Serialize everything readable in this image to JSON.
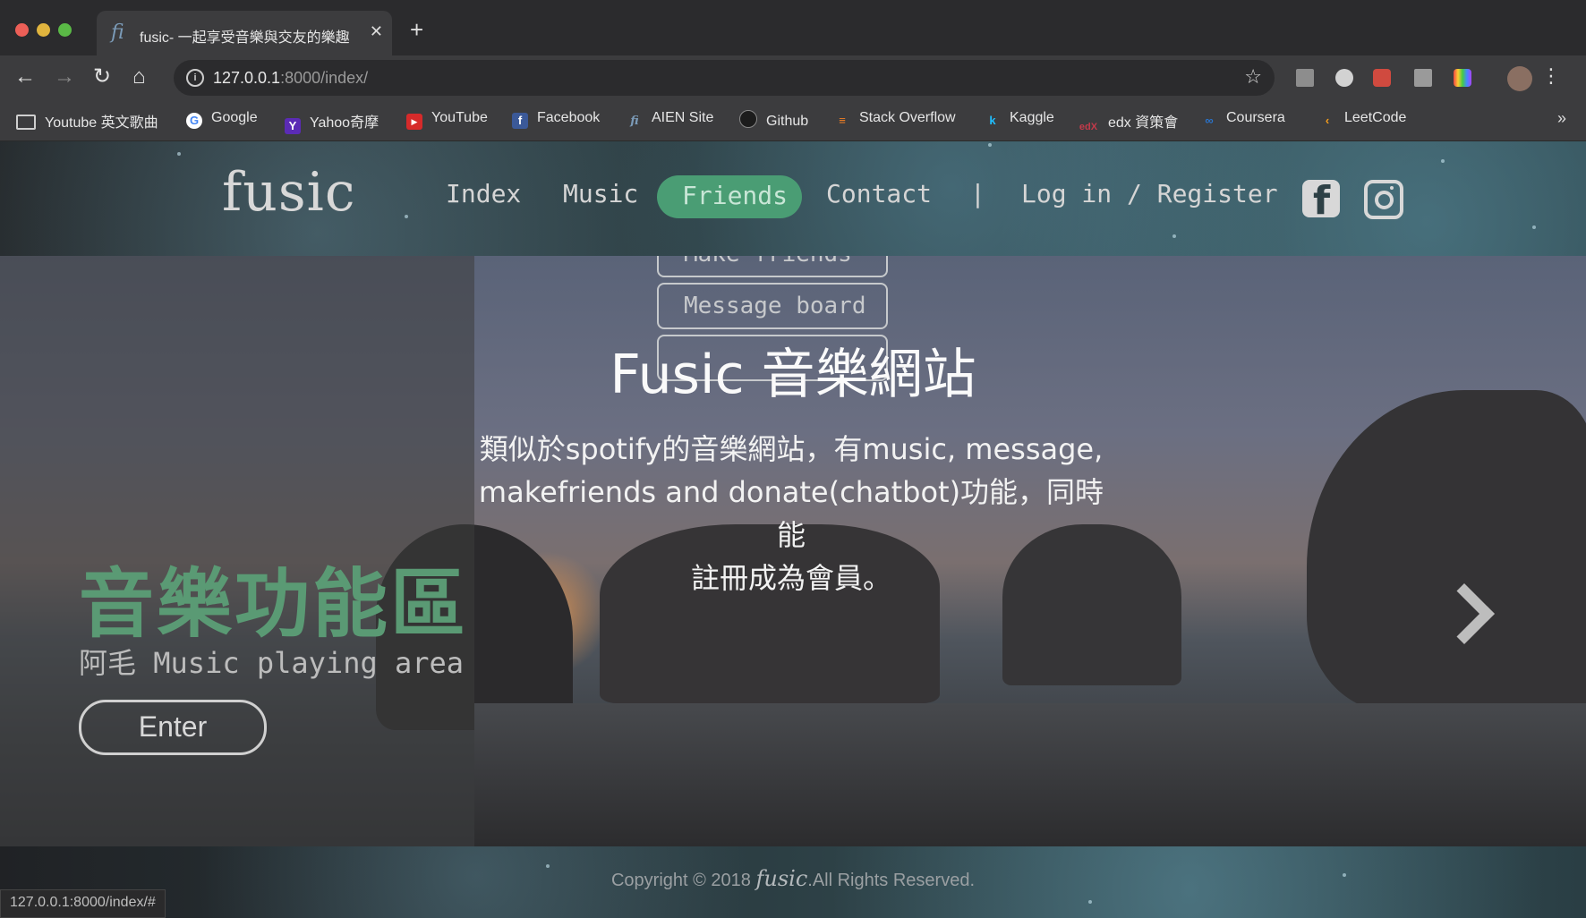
{
  "browser": {
    "tab_title": "fusic- 一起享受音樂與交友的樂趣",
    "new_tab": "+",
    "url_host": "127.0.0.1",
    "url_rest": ":8000/index/",
    "status_url": "127.0.0.1:8000/index/#"
  },
  "bookmarks": [
    {
      "label": "Youtube 英文歌曲",
      "icon": "folder-icon"
    },
    {
      "label": "Google",
      "icon": "google-icon"
    },
    {
      "label": "Yahoo奇摩",
      "icon": "yahoo-icon"
    },
    {
      "label": "YouTube",
      "icon": "youtube-icon"
    },
    {
      "label": "Facebook",
      "icon": "facebook-icon"
    },
    {
      "label": "AIEN Site",
      "icon": "aien-icon"
    },
    {
      "label": "Github",
      "icon": "github-icon"
    },
    {
      "label": "Stack Overflow",
      "icon": "stackoverflow-icon"
    },
    {
      "label": "Kaggle",
      "icon": "kaggle-icon"
    },
    {
      "label": "edx 資策會",
      "icon": "edx-icon"
    },
    {
      "label": "Coursera",
      "icon": "coursera-icon"
    },
    {
      "label": "LeetCode",
      "icon": "leetcode-icon"
    }
  ],
  "site": {
    "logo": "fusic",
    "nav": {
      "index": "Index",
      "music": "Music",
      "friends": "Friends",
      "contact": "Contact",
      "separator": "|",
      "login": "Log in / Register"
    },
    "dropdown": {
      "make_friends": "Make friends",
      "message_board": "Message board"
    },
    "hero": {
      "title": "Fusic 音樂網站",
      "desc_line1": "類似於spotify的音樂網站，有music, message,",
      "desc_line2": "makefriends and donate(chatbot)功能，同時能",
      "desc_line3": "註冊成為會員。"
    },
    "music_section": {
      "title": "音樂功能區",
      "subtitle": "阿毛 Music playing area",
      "enter": "Enter"
    },
    "footer": {
      "copyright_prefix": "Copyright © 2018",
      "brand": "fusic",
      "copyright_suffix": ".All Rights Reserved."
    }
  },
  "colors": {
    "accent": "#4a9d74",
    "music_title": "#5a9a74"
  }
}
